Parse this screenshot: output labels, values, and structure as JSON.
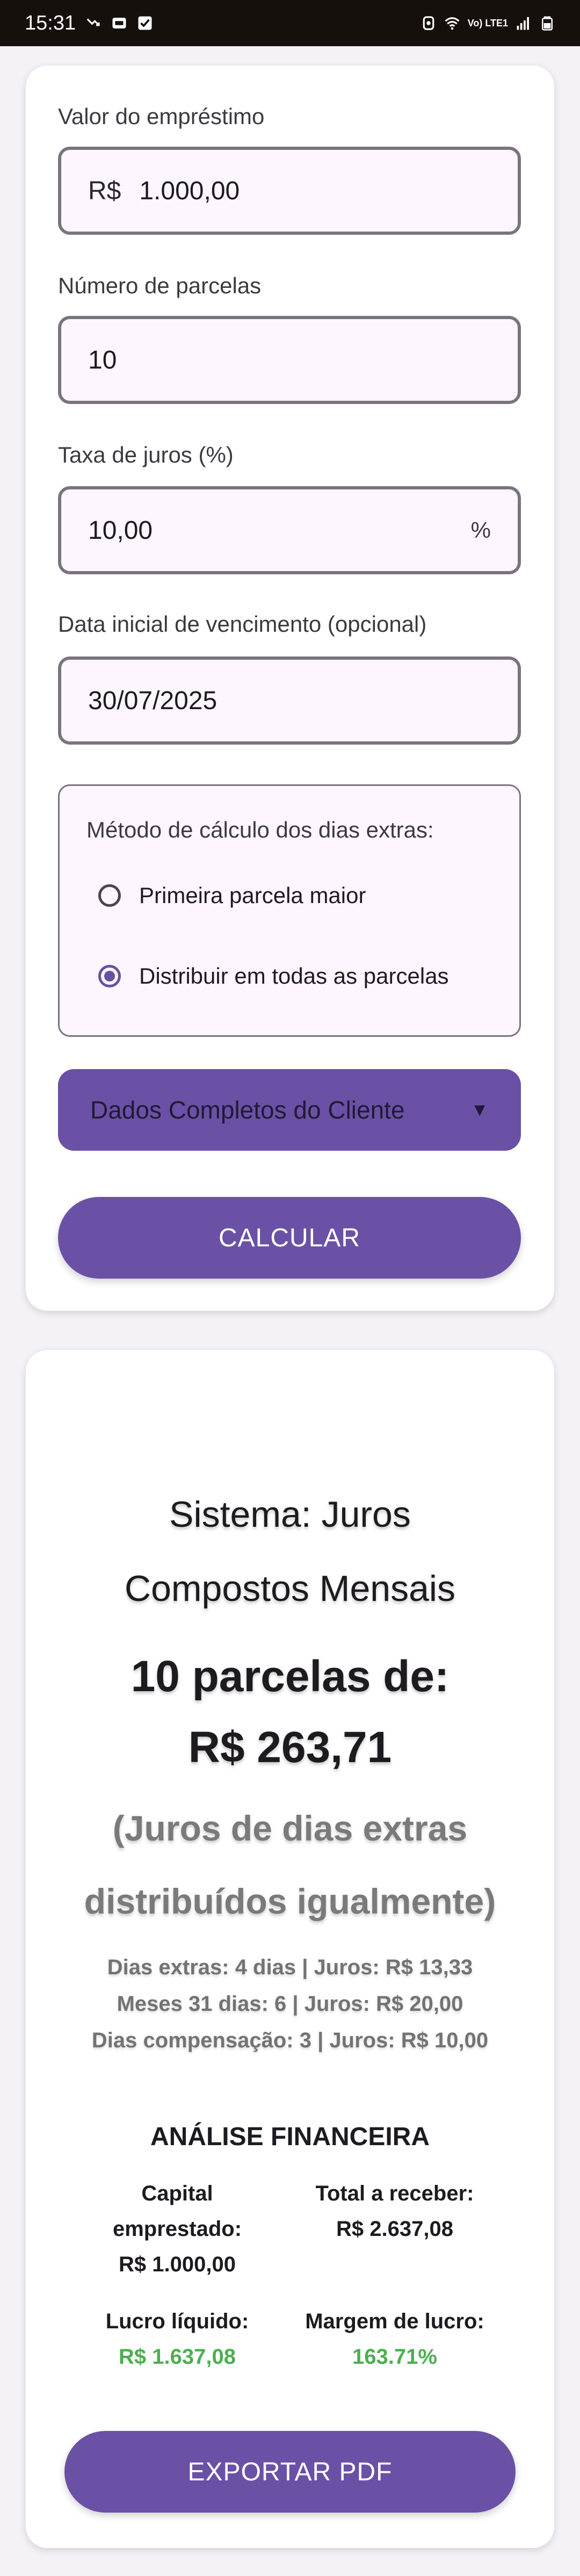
{
  "status_bar": {
    "time": "15:31",
    "network": "Vo) LTE1"
  },
  "form": {
    "loan_value": {
      "label": "Valor do empréstimo",
      "prefix": "R$",
      "value": "1.000,00"
    },
    "installments": {
      "label": "Número de parcelas",
      "value": "10"
    },
    "interest": {
      "label": "Taxa de juros (%)",
      "value": "10,00",
      "suffix": "%"
    },
    "start_date": {
      "label": "Data inicial de vencimento (opcional)",
      "value": "30/07/2025"
    },
    "method": {
      "title": "Método de cálculo dos dias extras:",
      "options": [
        {
          "label": "Primeira parcela maior",
          "selected": false
        },
        {
          "label": "Distribuir em todas as parcelas",
          "selected": true
        }
      ]
    },
    "client_dropdown": {
      "label": "Dados Completos do Cliente",
      "arrow": "▼"
    },
    "calculate_label": "CALCULAR"
  },
  "result": {
    "system_line1": "Sistema: Juros",
    "system_line2": "Compostos Mensais",
    "installments_line1": "10 parcelas de:",
    "installments_line2": "R$ 263,71",
    "note_line1": "(Juros de dias extras",
    "note_line2": "distribuídos igualmente)",
    "details": [
      "Dias extras: 4 dias | Juros: R$ 13,33",
      "Meses 31 dias: 6 | Juros: R$ 20,00",
      "Dias compensação: 3 | Juros: R$ 10,00"
    ],
    "analysis": {
      "title": "ANÁLISE FINANCEIRA",
      "capital_label_1": "Capital",
      "capital_label_2": "emprestado:",
      "capital_value": "R$ 1.000,00",
      "total_label": "Total a receber:",
      "total_value": "R$ 2.637,08",
      "profit_label": "Lucro líquido:",
      "profit_value": "R$ 1.637,08",
      "margin_label": "Margem de lucro:",
      "margin_value": "163.71%"
    },
    "export_label": "EXPORTAR PDF"
  },
  "colors": {
    "primary": "#6a51a6",
    "positive": "#4caf50"
  }
}
